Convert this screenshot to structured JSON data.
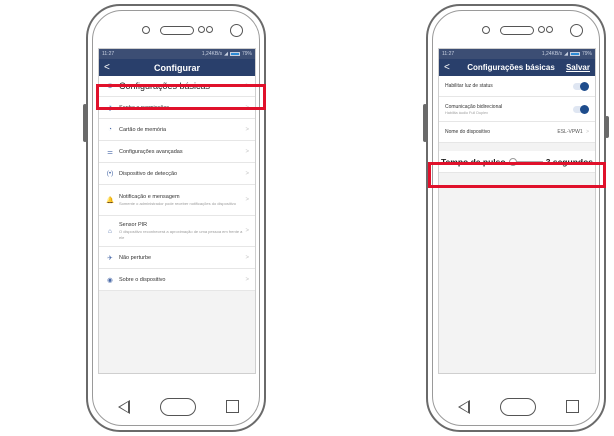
{
  "left": {
    "status_time": "11:27",
    "status_speed": "1,24KB/s",
    "status_battery": "79%",
    "back_glyph": "<",
    "title": "Configurar",
    "items": [
      {
        "icon": "settings-icon",
        "glyph": "⚙",
        "label": "Configurações básicas",
        "sub": ""
      },
      {
        "icon": "key-icon",
        "glyph": "⚷",
        "label": "Senha e permissões",
        "sub": ""
      },
      {
        "icon": "memory-card-icon",
        "glyph": "◔",
        "label": "Cartão de memória",
        "sub": ""
      },
      {
        "icon": "sliders-icon",
        "glyph": "⚌",
        "label": "Configurações avançadas",
        "sub": ""
      },
      {
        "icon": "detection-icon",
        "glyph": "(•)",
        "label": "Dispositivo de detecção",
        "sub": ""
      },
      {
        "icon": "bell-icon",
        "glyph": "🔔",
        "label": "Notificação e mensagem",
        "sub": "Somente o administrador pode receber notificações do dispositivo"
      },
      {
        "icon": "pir-sensor-icon",
        "glyph": "⌂",
        "label": "Sensor PIR",
        "sub": "O dispositivo reconhecerá a aproximação de uma pessoa em frente a ele"
      },
      {
        "icon": "do-not-disturb-icon",
        "glyph": "✈",
        "label": "Não perturbe",
        "sub": ""
      },
      {
        "icon": "info-icon",
        "glyph": "◉",
        "label": "Sobre o dispositivo",
        "sub": ""
      }
    ],
    "chevron": ">"
  },
  "right": {
    "status_time": "11:27",
    "status_speed": "1,24KB/s",
    "status_battery": "79%",
    "back_glyph": "<",
    "title": "Configurações básicas",
    "save": "Salvar",
    "status_light_label": "Habilitar luz de status",
    "status_light_on": true,
    "bidirectional_label": "Comunicação bidirecional",
    "bidirectional_sub": "Habilita áudio Full Duplex",
    "bidirectional_on": true,
    "device_name_label": "Nome do dispositivo",
    "device_name_value": "ESL-VPW1",
    "chevron": ">",
    "pulse_label": "Tempo de pulso",
    "pulse_value": "3 segundos"
  },
  "colors": {
    "header": "#293f6b",
    "highlight": "#e0112b",
    "toggle": "#1e4c8c"
  }
}
